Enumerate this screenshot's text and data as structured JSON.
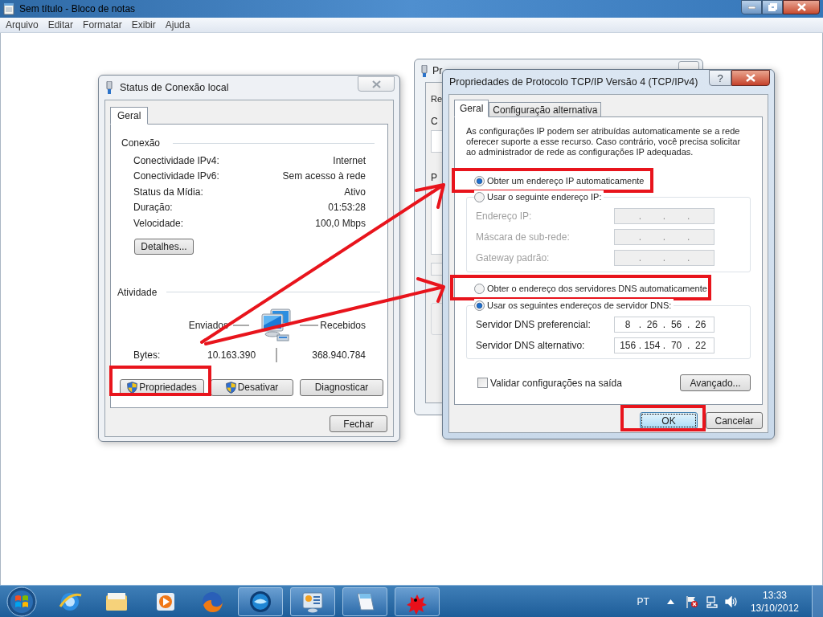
{
  "notepad": {
    "title": "Sem título - Bloco de notas",
    "menu": [
      "Arquivo",
      "Editar",
      "Formatar",
      "Exibir",
      "Ajuda"
    ]
  },
  "back_window": {
    "title": "Pr",
    "tab": "Re",
    "labels": [
      "C",
      "P"
    ]
  },
  "status_dialog": {
    "title": "Status de Conexão local",
    "tabs": [
      {
        "label": "Geral",
        "selected": true
      }
    ],
    "connection_heading": "Conexão",
    "rows": [
      {
        "label": "Conectividade IPv4:",
        "value": "Internet"
      },
      {
        "label": "Conectividade IPv6:",
        "value": "Sem acesso à rede"
      },
      {
        "label": "Status da Mídia:",
        "value": "Ativo"
      },
      {
        "label": "Duração:",
        "value": "01:53:28"
      },
      {
        "label": "Velocidade:",
        "value": "100,0 Mbps"
      }
    ],
    "details_button": "Detalhes...",
    "activity_heading": "Atividade",
    "sent_label": "Enviados",
    "received_label": "Recebidos",
    "bytes_label": "Bytes:",
    "bytes_sent": "10.163.390",
    "bytes_received": "368.940.784",
    "buttons": [
      {
        "label": "Propriedades",
        "shield": true
      },
      {
        "label": "Desativar",
        "shield": true
      },
      {
        "label": "Diagnosticar",
        "shield": false
      }
    ],
    "close_button": "Fechar"
  },
  "tcp_dialog": {
    "title": "Propriedades de Protocolo TCP/IP Versão 4 (TCP/IPv4)",
    "help": "?",
    "tabs": [
      {
        "label": "Geral",
        "selected": true
      },
      {
        "label": "Configuração alternativa",
        "selected": false
      }
    ],
    "description": "As configurações IP podem ser atribuídas automaticamente se a rede oferecer suporte a esse recurso. Caso contrário, você precisa solicitar ao administrador de rede as configurações IP adequadas.",
    "separator": ".",
    "ip_auto": {
      "label": "Obter um endereço IP automaticamente",
      "selected": true
    },
    "ip_manual": {
      "label": "Usar o seguinte endereço IP:",
      "selected": false
    },
    "ip_fields": [
      {
        "label": "Endereço IP:",
        "disabled": true
      },
      {
        "label": "Máscara de sub-rede:",
        "disabled": true
      },
      {
        "label": "Gateway padrão:",
        "disabled": true
      }
    ],
    "dns_auto": {
      "label": "Obter o endereço dos servidores DNS automaticamente",
      "selected": false
    },
    "dns_manual": {
      "label": "Usar os seguintes endereços de servidor DNS:",
      "selected": true
    },
    "dns_fields": [
      {
        "label": "Servidor DNS preferencial:",
        "disabled": false,
        "octets": [
          "8",
          "26",
          "56",
          "26"
        ]
      },
      {
        "label": "Servidor DNS alternativo:",
        "disabled": false,
        "octets": [
          "156",
          "154",
          "70",
          "22"
        ]
      }
    ],
    "validate": {
      "label": "Validar configurações na saída",
      "checked": false
    },
    "advanced_button": "Avançado...",
    "ok_button": "OK",
    "cancel_button": "Cancelar"
  },
  "taskbar": {
    "language": "PT",
    "time": "13:33",
    "date": "13/10/2012"
  }
}
